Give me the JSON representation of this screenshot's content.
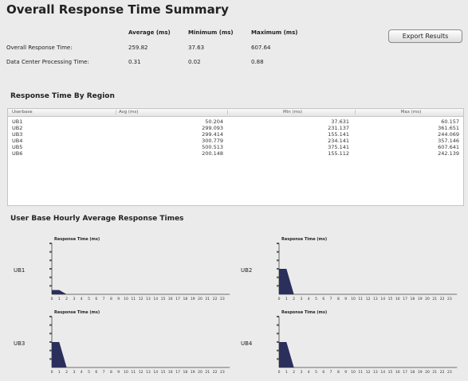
{
  "title": "Overall Response Time Summary",
  "summary": {
    "headers": [
      "Average (ms)",
      "Minimum (ms)",
      "Maximum (ms)"
    ],
    "rows": [
      {
        "label": "Overall Response Time:",
        "avg": "259.82",
        "min": "37.63",
        "max": "607.64"
      },
      {
        "label": "Data Center Processing Time:",
        "avg": "0.31",
        "min": "0.02",
        "max": "0.88"
      }
    ]
  },
  "export_button": "Export Results",
  "region_section_title": "Response Time By Region",
  "region_table": {
    "headers": [
      "Userbase",
      "Avg (ms)",
      "Min (ms)",
      "Max (ms)"
    ],
    "rows": [
      [
        "UB1",
        "50.204",
        "37.631",
        "60.157"
      ],
      [
        "UB2",
        "299.093",
        "231.137",
        "361.651"
      ],
      [
        "UB3",
        "299.414",
        "155.141",
        "244.069"
      ],
      [
        "UB4",
        "300.779",
        "234.141",
        "357.146"
      ],
      [
        "UB5",
        "500.513",
        "375.141",
        "607.641"
      ],
      [
        "UB6",
        "200.148",
        "155.112",
        "242.139"
      ]
    ]
  },
  "hourly_section_title": "User Base Hourly Average Response Times",
  "chart_data": [
    {
      "type": "area",
      "label": "UB1",
      "title": "Response Time (ms)",
      "xlabel": "Hrs",
      "x": [
        0,
        1,
        2,
        3,
        4,
        5,
        6,
        7,
        8,
        9,
        10,
        11,
        12,
        13,
        14,
        15,
        16,
        17,
        18,
        19,
        20,
        21,
        22,
        23
      ],
      "values": [
        50,
        50,
        0,
        0,
        0,
        0,
        0,
        0,
        0,
        0,
        0,
        0,
        0,
        0,
        0,
        0,
        0,
        0,
        0,
        0,
        0,
        0,
        0,
        0
      ],
      "ylim": [
        0,
        600
      ]
    },
    {
      "type": "area",
      "label": "UB2",
      "title": "Response Time (ms)",
      "xlabel": "Hrs",
      "x": [
        0,
        1,
        2,
        3,
        4,
        5,
        6,
        7,
        8,
        9,
        10,
        11,
        12,
        13,
        14,
        15,
        16,
        17,
        18,
        19,
        20,
        21,
        22,
        23
      ],
      "values": [
        300,
        300,
        0,
        0,
        0,
        0,
        0,
        0,
        0,
        0,
        0,
        0,
        0,
        0,
        0,
        0,
        0,
        0,
        0,
        0,
        0,
        0,
        0,
        0
      ],
      "ylim": [
        0,
        600
      ]
    },
    {
      "type": "area",
      "label": "UB3",
      "title": "Response Time (ms)",
      "xlabel": "Hrs",
      "x": [
        0,
        1,
        2,
        3,
        4,
        5,
        6,
        7,
        8,
        9,
        10,
        11,
        12,
        13,
        14,
        15,
        16,
        17,
        18,
        19,
        20,
        21,
        22,
        23
      ],
      "values": [
        300,
        300,
        0,
        0,
        0,
        0,
        0,
        0,
        0,
        0,
        0,
        0,
        0,
        0,
        0,
        0,
        0,
        0,
        0,
        0,
        0,
        0,
        0,
        0
      ],
      "ylim": [
        0,
        600
      ]
    },
    {
      "type": "area",
      "label": "UB4",
      "title": "Response Time (ms)",
      "xlabel": "Hrs",
      "x": [
        0,
        1,
        2,
        3,
        4,
        5,
        6,
        7,
        8,
        9,
        10,
        11,
        12,
        13,
        14,
        15,
        16,
        17,
        18,
        19,
        20,
        21,
        22,
        23
      ],
      "values": [
        300,
        300,
        0,
        0,
        0,
        0,
        0,
        0,
        0,
        0,
        0,
        0,
        0,
        0,
        0,
        0,
        0,
        0,
        0,
        0,
        0,
        0,
        0,
        0
      ],
      "ylim": [
        0,
        600
      ]
    }
  ],
  "colors": {
    "chart_fill": "#2b2f5c",
    "background": "#ebebeb"
  }
}
